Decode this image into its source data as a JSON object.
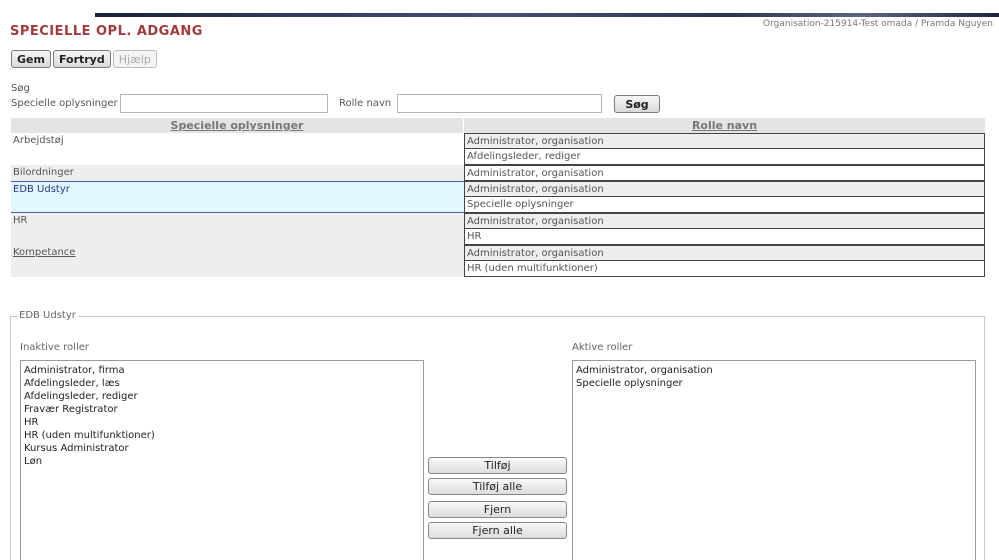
{
  "header": {
    "org_user": "Organisation-215914-Test omada / Pramda Nguyen",
    "title": "SPECIELLE OPL. ADGANG"
  },
  "toolbar": {
    "save_label": "Gem",
    "undo_label": "Fortryd",
    "help_label": "Hjælp"
  },
  "search": {
    "heading": "Søg",
    "field1_label": "Specielle oplysninger",
    "field1_value": "",
    "field2_label": "Rolle navn",
    "field2_value": "",
    "button_label": "Søg"
  },
  "grid": {
    "col1_header": "Specielle oplysninger",
    "col2_header": "Rolle navn",
    "rows": [
      {
        "name": "Arbejdstøj",
        "roles": [
          "Administrator, organisation",
          "Afdelingsleder, rediger"
        ]
      },
      {
        "name": "Bilordninger",
        "roles": [
          "Administrator, organisation"
        ]
      },
      {
        "name": "EDB Udstyr",
        "roles": [
          "Administrator, organisation",
          "Specielle oplysninger"
        ]
      },
      {
        "name": "HR",
        "roles": [
          "Administrator, organisation",
          "HR"
        ]
      },
      {
        "name": "Kompetance",
        "roles": [
          "Administrator, organisation",
          "HR (uden multifunktioner)"
        ]
      }
    ]
  },
  "detail": {
    "legend": "EDB Udstyr",
    "inactive_label": "Inaktive roller",
    "active_label": "Aktive roller",
    "inactive_roles": [
      "Administrator, firma",
      "Afdelingsleder, læs",
      "Afdelingsleder, rediger",
      "Fravær Registrator",
      "HR",
      "HR (uden multifunktioner)",
      "Kursus Administrator",
      "Løn"
    ],
    "active_roles": [
      "Administrator, organisation",
      "Specielle oplysninger"
    ],
    "add_label": "Tilføj",
    "add_all_label": "Tilføj alle",
    "remove_label": "Fjern",
    "remove_all_label": "Fjern alle"
  }
}
